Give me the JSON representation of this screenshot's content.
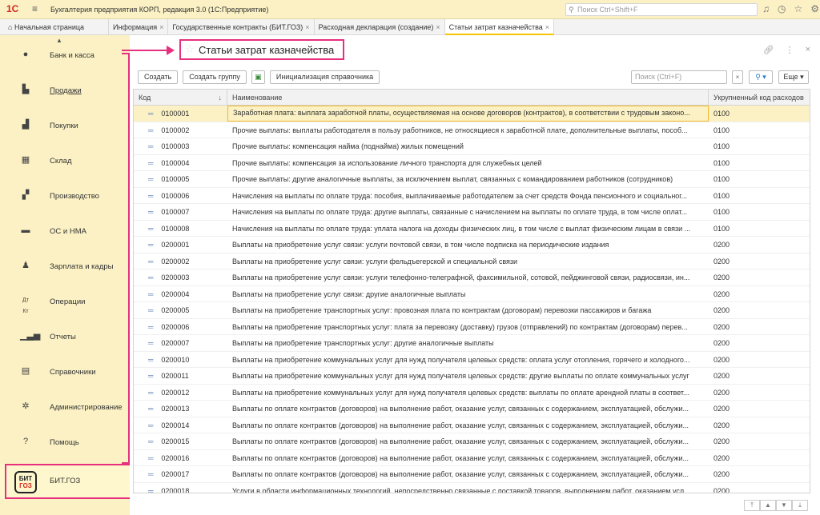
{
  "titlebar": {
    "logo": "1С",
    "app_title": "Бухгалтерия предприятия КОРП, редакция 3.0  (1С:Предприятие)",
    "search_placeholder": "Поиск Ctrl+Shift+F"
  },
  "tabs": [
    {
      "label": "Начальная страница",
      "closable": false
    },
    {
      "label": "Информация",
      "closable": true
    },
    {
      "label": "Государственные контракты (БИТ.ГОЗ)",
      "closable": true
    },
    {
      "label": "Расходная декларация (создание)",
      "closable": true
    },
    {
      "label": "Статьи затрат казначейства",
      "closable": true,
      "active": true
    }
  ],
  "sidebar": {
    "items": [
      {
        "label": "Банк и касса",
        "icon": "coin-icon"
      },
      {
        "label": "Продажи",
        "icon": "bag-icon"
      },
      {
        "label": "Покупки",
        "icon": "cart-icon"
      },
      {
        "label": "Склад",
        "icon": "warehouse-icon"
      },
      {
        "label": "Производство",
        "icon": "factory-icon"
      },
      {
        "label": "ОС и НМА",
        "icon": "truck-icon"
      },
      {
        "label": "Зарплата и кадры",
        "icon": "person-icon"
      },
      {
        "label": "Операции",
        "icon": "dt-kt-icon"
      },
      {
        "label": "Отчеты",
        "icon": "bar-chart-icon"
      },
      {
        "label": "Справочники",
        "icon": "books-icon"
      },
      {
        "label": "Администрирование",
        "icon": "gear-icon"
      },
      {
        "label": "Помощь",
        "icon": "question-icon"
      },
      {
        "label": "БИТ.ГОЗ",
        "icon": "bit-goz-logo"
      }
    ],
    "bit_logo_top": "БИТ",
    "bit_logo_bottom": "ГОЗ"
  },
  "form": {
    "title": "Статьи затрат казначейства",
    "toolbar": {
      "create": "Создать",
      "create_group": "Создать группу",
      "init": "Инициализация справочника",
      "search_placeholder": "Поиск (Ctrl+F)",
      "more": "Еще"
    },
    "columns": {
      "code": "Код",
      "name": "Наименование",
      "agg": "Укрупненный код расходов"
    },
    "rows": [
      {
        "code": "0100001",
        "name": "Заработная плата: выплата заработной платы, осуществляемая на основе договоров (контрактов), в соответствии с трудовым законо...",
        "agg": "0100"
      },
      {
        "code": "0100002",
        "name": "Прочие выплаты: выплаты работодателя в пользу работников, не относящиеся к заработной плате, дополнительные выплаты, пособ...",
        "agg": "0100"
      },
      {
        "code": "0100003",
        "name": "Прочие выплаты: компенсация найма (поднайма) жилых помещений",
        "agg": "0100"
      },
      {
        "code": "0100004",
        "name": "Прочие выплаты: компенсация за использование личного транспорта для служебных целей",
        "agg": "0100"
      },
      {
        "code": "0100005",
        "name": "Прочие выплаты: другие аналогичные выплаты, за исключением выплат, связанных с командированием работников (сотрудников)",
        "agg": "0100"
      },
      {
        "code": "0100006",
        "name": "Начисления на выплаты по оплате труда: пособия, выплачиваемые работодателем за счет средств Фонда пенсионного и социальног...",
        "agg": "0100"
      },
      {
        "code": "0100007",
        "name": "Начисления на выплаты по оплате труда: другие выплаты, связанные с начислением на выплаты по оплате труда, в том числе оплат...",
        "agg": "0100"
      },
      {
        "code": "0100008",
        "name": "Начисления на выплаты по оплате труда: уплата налога на доходы физических лиц, в том числе с выплат физическим лицам в связи ...",
        "agg": "0100"
      },
      {
        "code": "0200001",
        "name": "Выплаты на приобретение услуг связи: услуги почтовой связи, в том числе подписка на периодические издания",
        "agg": "0200"
      },
      {
        "code": "0200002",
        "name": "Выплаты на приобретение услуг связи: услуги фельдъегерской и специальной связи",
        "agg": "0200"
      },
      {
        "code": "0200003",
        "name": "Выплаты на приобретение услуг связи: услуги телефонно-телеграфной, факсимильной, сотовой, пейджинговой связи, радиосвязи, ин...",
        "agg": "0200"
      },
      {
        "code": "0200004",
        "name": "Выплаты на приобретение услуг связи: другие аналогичные выплаты",
        "agg": "0200"
      },
      {
        "code": "0200005",
        "name": "Выплаты на приобретение транспортных услуг: провозная плата по контрактам (договорам) перевозки пассажиров и багажа",
        "agg": "0200"
      },
      {
        "code": "0200006",
        "name": "Выплаты на приобретение транспортных услуг: плата за перевозку (доставку) грузов (отправлений) по контрактам (договорам) перев...",
        "agg": "0200"
      },
      {
        "code": "0200007",
        "name": "Выплаты на приобретение транспортных услуг: другие аналогичные выплаты",
        "agg": "0200"
      },
      {
        "code": "0200010",
        "name": "Выплаты на приобретение коммунальных услуг для нужд получателя целевых средств: оплата услуг отопления, горячего и холодного...",
        "agg": "0200"
      },
      {
        "code": "0200011",
        "name": "Выплаты на приобретение коммунальных услуг для нужд получателя целевых средств: другие выплаты по оплате коммунальных услуг",
        "agg": "0200"
      },
      {
        "code": "0200012",
        "name": "Выплаты на приобретение коммунальных услуг для нужд получателя целевых средств: выплаты по оплате арендной платы в соответ...",
        "agg": "0200"
      },
      {
        "code": "0200013",
        "name": "Выплаты по оплате контрактов (договоров) на выполнение работ, оказание услуг, связанных с содержанием, эксплуатацией, обслужи...",
        "agg": "0200"
      },
      {
        "code": "0200014",
        "name": "Выплаты по оплате контрактов (договоров) на выполнение работ, оказание услуг, связанных с содержанием, эксплуатацией, обслужи...",
        "agg": "0200"
      },
      {
        "code": "0200015",
        "name": "Выплаты по оплате контрактов (договоров) на выполнение работ, оказание услуг, связанных с содержанием, эксплуатацией, обслужи...",
        "agg": "0200"
      },
      {
        "code": "0200016",
        "name": "Выплаты по оплате контрактов (договоров) на выполнение работ, оказание услуг, связанных с содержанием, эксплуатацией, обслужи...",
        "agg": "0200"
      },
      {
        "code": "0200017",
        "name": "Выплаты по оплате контрактов (договоров) на выполнение работ, оказание услуг, связанных с содержанием, эксплуатацией, обслужи...",
        "agg": "0200"
      },
      {
        "code": "0200018",
        "name": "Услуги в области информационных технологий, непосредственно связанные с поставкой товаров, выполнением работ, оказанием усл...",
        "agg": "0200"
      }
    ]
  },
  "colors": {
    "accent_yellow": "#fbf1c4",
    "highlight_pink": "#e6307e",
    "selection_border": "#f1b82c"
  }
}
